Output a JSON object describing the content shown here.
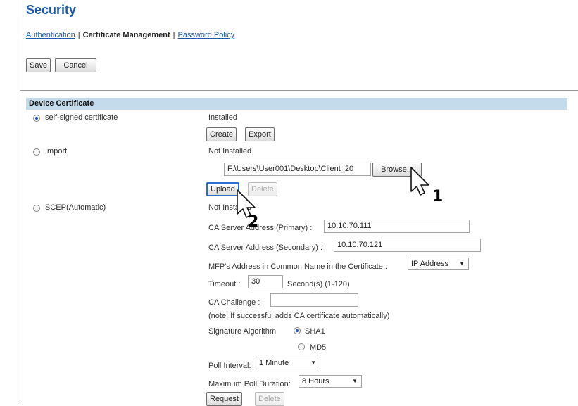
{
  "page": {
    "title": "Security",
    "subnav": {
      "authentication": "Authentication",
      "separator": "|",
      "certificate_management": "Certificate Management",
      "password_policy": "Password Policy"
    },
    "buttons": {
      "save": "Save",
      "cancel": "Cancel"
    }
  },
  "device_certificate": {
    "section_title": "Device Certificate",
    "self_signed": {
      "label": "self-signed certificate",
      "status": "Installed",
      "create": "Create",
      "export": "Export"
    },
    "import": {
      "label": "Import",
      "status": "Not Installed",
      "file_path": "F:\\Users\\User001\\Desktop\\Client_20",
      "browse": "Browse...",
      "upload": "Upload",
      "delete": "Delete"
    },
    "scep": {
      "label": "SCEP(Automatic)",
      "status": "Not Installed",
      "ca_primary_label": "CA Server Address (Primary)  :",
      "ca_primary_value": "10.10.70.111",
      "ca_secondary_label": "CA Server Address (Secondary)  :",
      "ca_secondary_value": "10.10.70.121",
      "mfp_cn_label": "MFP's Address in Common Name in the Certificate  :",
      "mfp_cn_value": "IP Address",
      "timeout_label": "Timeout  :",
      "timeout_value": "30",
      "timeout_unit": "Second(s) (1-120)",
      "challenge_label": "CA Challenge  :",
      "challenge_value": "",
      "note": "(note: If successful adds CA certificate automatically)",
      "signature_label": "Signature Algorithm",
      "sha1": "SHA1",
      "md5": "MD5",
      "poll_interval_label": "Poll Interval:",
      "poll_interval_value": "1 Minute",
      "max_poll_label": "Maximum Poll Duration:",
      "max_poll_value": "8 Hours",
      "request": "Request",
      "delete": "Delete"
    }
  },
  "callouts": {
    "step1": "1",
    "step2": "2"
  },
  "colors": {
    "title_blue": "#1e5aa8",
    "section_bg": "#c4dbeb",
    "radio_dot": "#1e4ea8"
  },
  "icons": [
    "mouse-pointer-icon"
  ]
}
